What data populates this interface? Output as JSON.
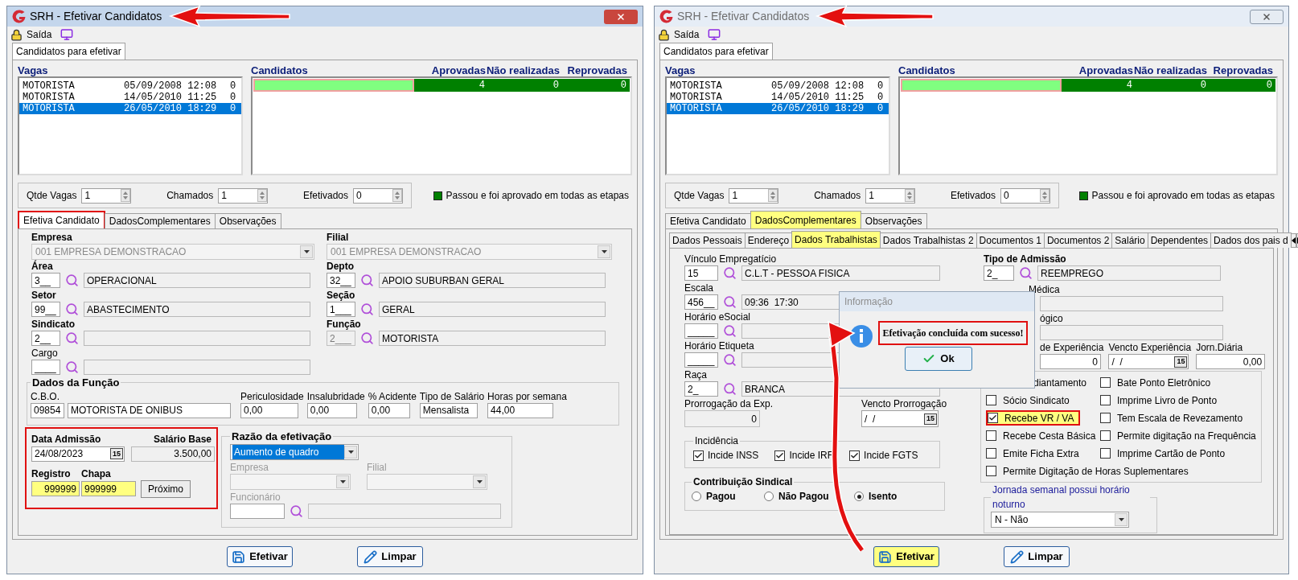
{
  "windows": [
    {
      "title": "SRH - Efetivar Candidatos",
      "active": true,
      "toolbar": {
        "label": "Saída"
      },
      "outer_tab": {
        "label": "Candidatos para efetivar",
        "selected": true
      },
      "vagas": {
        "label": "Vagas",
        "rows": [
          {
            "cells": [
              "MOTORISTA",
              "05/09/2008 12:08",
              "0"
            ],
            "selected": false
          },
          {
            "cells": [
              "MOTORISTA",
              "14/05/2010 11:25",
              "0"
            ],
            "selected": false
          },
          {
            "cells": [
              "MOTORISTA",
              "26/05/2010 18:29",
              "0"
            ],
            "selected": true
          }
        ]
      },
      "candidatos": {
        "columns": [
          "Candidatos",
          "Aprovadas",
          "Não realizadas",
          "Reprovadas"
        ],
        "rows": [
          {
            "cells": [
              "",
              "4",
              "0",
              "0"
            ]
          }
        ]
      },
      "counts": [
        {
          "label": "Qtde Vagas",
          "value": "1"
        },
        {
          "label": "Chamados",
          "value": "1"
        },
        {
          "label": "Efetivados",
          "value": "0"
        }
      ],
      "legend": {
        "color": "#008000",
        "label": "Passou e foi aprovado em todas as etapas"
      },
      "tabs": [
        {
          "label": "Efetiva Candidato",
          "selected": true,
          "marked": true,
          "highlighted": false
        },
        {
          "label": "DadosComplementares",
          "selected": false,
          "marked": false,
          "highlighted": false
        },
        {
          "label": "Observações",
          "selected": false,
          "marked": false,
          "highlighted": false
        }
      ],
      "content": {
        "kind": "efetiva",
        "empresa": {
          "label": "Empresa",
          "value": "001 EMPRESA DEMONSTRACAO"
        },
        "filial": {
          "label": "Filial",
          "value": "001 EMPRESA DEMONSTRACAO"
        },
        "lookups": [
          {
            "label": "Área",
            "required": true,
            "code": "3__",
            "disabled": false,
            "desc": "OPERACIONAL"
          },
          {
            "label": "Depto",
            "required": true,
            "code": "32__",
            "disabled": false,
            "desc": "APOIO SUBURBAN GERAL"
          },
          {
            "label": "Setor",
            "required": true,
            "code": "99__",
            "disabled": false,
            "desc": "ABASTECIMENTO"
          },
          {
            "label": "Seção",
            "required": true,
            "code": "1___",
            "disabled": false,
            "desc": "GERAL"
          },
          {
            "label": "Sindicato",
            "required": true,
            "code": "2__",
            "disabled": false
          },
          {
            "label": "Função",
            "required": true,
            "code": "2___",
            "disabled": true,
            "desc": "MOTORISTA"
          },
          {
            "label": "Cargo",
            "required": false,
            "code": "____",
            "disabled": false
          }
        ],
        "dados_funcao": {
          "title": "Dados da Função",
          "cbo_label": "C.B.O.",
          "cbo_code": "09854",
          "cbo_desc": "MOTORISTA DE ONIBUS",
          "fields": [
            {
              "label": "Periculosidade",
              "value": "0,00"
            },
            {
              "label": "Insalubridade",
              "value": "0,00"
            },
            {
              "label": "% Acidente",
              "value": "0,00"
            },
            {
              "label": "Tipo de Salário",
              "value": "Mensalista"
            },
            {
              "label": "Horas por semana",
              "value": "44,00"
            }
          ]
        },
        "admissao": {
          "marked": true,
          "date_label": "Data Admissão",
          "date": "24/08/2023",
          "calendar_day": "15",
          "salary_label": "Salário Base",
          "salary": "3.500,00",
          "registro": {
            "label": "Registro",
            "value": "999999",
            "highlighted": true
          },
          "chapa": {
            "label": "Chapa",
            "value": "999999",
            "highlighted": true
          },
          "next_button": "Próximo"
        },
        "razao": {
          "title": "Razão da efetivação",
          "value": "Aumento de quadro",
          "empresa_label": "Empresa",
          "filial_label": "Filial",
          "funcionario_label": "Funcionário"
        }
      },
      "buttons": [
        {
          "label": "Efetivar",
          "highlighted": false
        },
        {
          "label": "Limpar",
          "highlighted": false
        }
      ]
    },
    {
      "title": "SRH - Efetivar Candidatos",
      "active": false,
      "toolbar": {
        "label": "Saída"
      },
      "outer_tab": {
        "label": "Candidatos para efetivar",
        "selected": true
      },
      "vagas": {
        "label": "Vagas",
        "rows": [
          {
            "cells": [
              "MOTORISTA",
              "05/09/2008 12:08",
              "0"
            ],
            "selected": false
          },
          {
            "cells": [
              "MOTORISTA",
              "14/05/2010 11:25",
              "0"
            ],
            "selected": false
          },
          {
            "cells": [
              "MOTORISTA",
              "26/05/2010 18:29",
              "0"
            ],
            "selected": true
          }
        ]
      },
      "candidatos": {
        "columns": [
          "Candidatos",
          "Aprovadas",
          "Não realizadas",
          "Reprovadas"
        ],
        "rows": [
          {
            "cells": [
              "",
              "4",
              "0",
              "0"
            ]
          }
        ]
      },
      "counts": [
        {
          "label": "Qtde Vagas",
          "value": "1"
        },
        {
          "label": "Chamados",
          "value": "1"
        },
        {
          "label": "Efetivados",
          "value": "0"
        }
      ],
      "legend": {
        "color": "#008000",
        "label": "Passou e foi aprovado em todas as etapas"
      },
      "tabs": [
        {
          "label": "Efetiva Candidato",
          "selected": false,
          "marked": false,
          "highlighted": false
        },
        {
          "label": "DadosComplementares",
          "selected": true,
          "marked": false,
          "highlighted": true
        },
        {
          "label": "Observações",
          "selected": false,
          "marked": false,
          "highlighted": false
        }
      ],
      "content": {
        "kind": "dados",
        "subtabs": [
          {
            "label": "Dados Pessoais",
            "selected": false,
            "highlighted": false
          },
          {
            "label": "Endereço",
            "selected": false,
            "highlighted": false
          },
          {
            "label": "Dados Trabalhistas",
            "selected": true,
            "highlighted": true
          },
          {
            "label": "Dados Trabalhistas 2",
            "selected": false,
            "highlighted": false
          },
          {
            "label": "Documentos 1",
            "selected": false,
            "highlighted": false
          },
          {
            "label": "Documentos 2",
            "selected": false,
            "highlighted": false
          },
          {
            "label": "Salário",
            "selected": false,
            "highlighted": false
          },
          {
            "label": "Dependentes",
            "selected": false,
            "highlighted": false
          },
          {
            "label": "Dados dos pais d",
            "selected": false,
            "highlighted": false
          }
        ],
        "lookups": [
          {
            "label": "Vínculo Empregatício",
            "code": "15",
            "desc": "C.L.T - PESSOA FISICA"
          },
          {
            "label": "Escala",
            "code": "456__",
            "desc": "09:36  17:30"
          },
          {
            "label": "Horário eSocial",
            "code": "_____"
          },
          {
            "label": "Horário Etiqueta",
            "code": "_____"
          },
          {
            "label": "Raça",
            "code": "2_",
            "desc": "BRANCA"
          }
        ],
        "prorrogacao": {
          "label": "Prorrogação da Exp.",
          "value": "0"
        },
        "vencto_prorrogacao": {
          "label": "Vencto Prorrogação",
          "value": "/  /",
          "calendar_day": "15"
        },
        "incidencia": {
          "title": "Incidência",
          "items": [
            {
              "label": "Incide INSS",
              "checked": true
            },
            {
              "label": "Incide IRF",
              "checked": true
            },
            {
              "label": "Incide FGTS",
              "checked": true
            }
          ]
        },
        "contribuicao": {
          "title": "Contribuição Sindical",
          "options": [
            {
              "label": "Pagou",
              "selected": false
            },
            {
              "label": "Não Pagou",
              "selected": false
            },
            {
              "label": "Isento",
              "selected": true
            }
          ]
        },
        "tipo_admissao": {
          "label": "Tipo de Admissão",
          "code": "2_",
          "desc": "REEMPREGO"
        },
        "covered_labels": [
          "Médica",
          "ógico"
        ],
        "experiencia": [
          {
            "label": "de Experiência",
            "value": "0"
          },
          {
            "label": "Vencto Experiência",
            "value": "/  /",
            "calendar_day": "15"
          },
          {
            "label": "Jorn.Diária",
            "value": "0,00"
          }
        ],
        "flags": [
          {
            "label": "diantamento",
            "covered": true
          },
          {
            "label": "Bate Ponto Eletrônico",
            "checked": false,
            "covered": false,
            "marked": false,
            "highlighted": false
          },
          {
            "label": "Sócio Sindicato",
            "checked": false,
            "covered": false,
            "marked": false,
            "highlighted": false
          },
          {
            "label": "Imprime Livro de Ponto",
            "checked": false,
            "covered": false,
            "marked": false,
            "highlighted": false
          },
          {
            "label": "Recebe VR / VA",
            "checked": true,
            "covered": false,
            "marked": true,
            "highlighted": true
          },
          {
            "label": "Tem Escala de Revezamento",
            "checked": false,
            "covered": false,
            "marked": false,
            "highlighted": false
          },
          {
            "label": "Recebe Cesta Básica",
            "checked": false,
            "covered": false,
            "marked": false,
            "highlighted": false
          },
          {
            "label": "Permite digitação na Frequência",
            "checked": false,
            "covered": false,
            "marked": false,
            "highlighted": false
          },
          {
            "label": "Emite Ficha Extra",
            "checked": false,
            "covered": false,
            "marked": false,
            "highlighted": false
          },
          {
            "label": "Imprime Cartão de Ponto",
            "checked": false,
            "covered": false,
            "marked": false,
            "highlighted": false
          },
          {
            "label": "Permite Digitação de Horas Suplementares",
            "checked": false,
            "covered": false,
            "marked": false,
            "highlighted": false
          }
        ],
        "jornada": {
          "title": "Jornada semanal possui horário noturno",
          "value": "N - Não"
        },
        "dialog": {
          "title": "Informação",
          "message": "Efetivação concluída com sucesso!",
          "marked": true,
          "button": "Ok"
        }
      },
      "buttons": [
        {
          "label": "Efetivar",
          "highlighted": true
        },
        {
          "label": "Limpar",
          "highlighted": false
        }
      ]
    }
  ]
}
